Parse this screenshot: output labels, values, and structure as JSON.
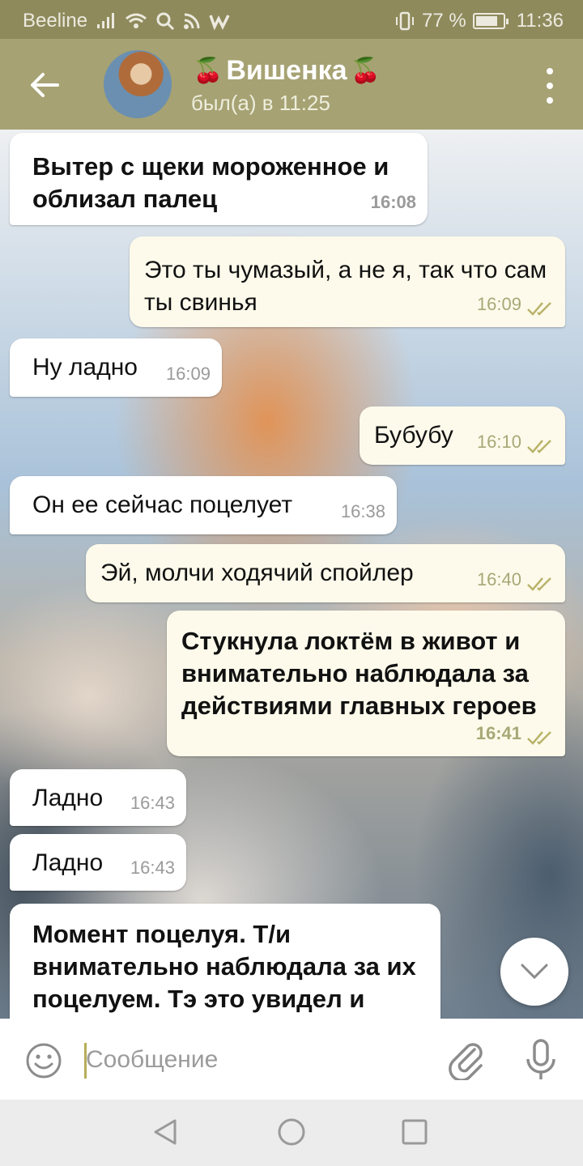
{
  "status_bar": {
    "carrier": "Beeline",
    "battery": "77 %",
    "time": "11:36"
  },
  "header": {
    "title": "Вишенка",
    "title_emoji": "🍒",
    "subtitle": "был(а) в 11:25"
  },
  "messages": [
    {
      "dir": "in",
      "text": "Вытер с щеки мороженное и облизал палец",
      "time": "16:08"
    },
    {
      "dir": "out",
      "text": "Это ты чумазый, а не я, так что сам ты свинья",
      "time": "16:09"
    },
    {
      "dir": "in",
      "text": "Ну ладно",
      "time": "16:09"
    },
    {
      "dir": "out",
      "text": "Бубубу",
      "time": "16:10"
    },
    {
      "dir": "in",
      "text": "Он ее сейчас поцелует",
      "time": "16:38"
    },
    {
      "dir": "out",
      "text": "Эй, молчи ходячий спойлер",
      "time": "16:40"
    },
    {
      "dir": "out",
      "text": "Стукнула локтём в живот и внимательно наблюдала за действиями главных героев",
      "time": "16:41"
    },
    {
      "dir": "in",
      "text": "Ладно",
      "time": "16:43"
    },
    {
      "dir": "in",
      "text": "Ладно",
      "time": "16:43"
    },
    {
      "dir": "in",
      "text": "Момент поцелуя. Т/и внимательно наблюдала за их поцелуем. Тэ это увидел и",
      "time": ""
    }
  ],
  "composer": {
    "placeholder": "Сообщение"
  },
  "colors": {
    "header": "#a6a273",
    "statusbar": "#8e8a5c",
    "outgoing_bubble": "#fdfaeb",
    "incoming_bubble": "#ffffff",
    "read_check": "#b9b36a"
  }
}
